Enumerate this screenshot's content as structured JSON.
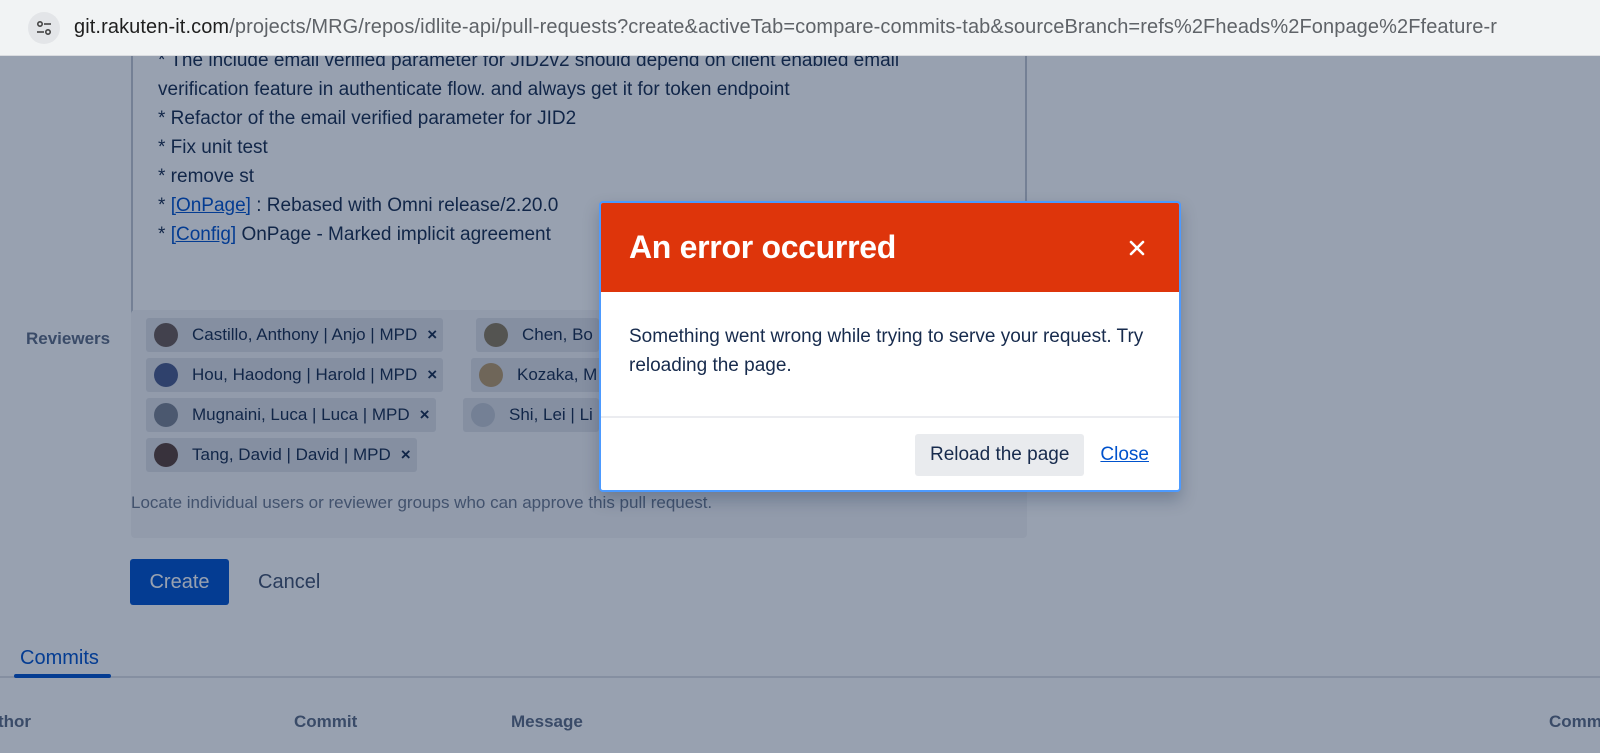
{
  "browser": {
    "url_host": "git.rakuten-it.com",
    "url_path": "/projects/MRG/repos/idlite-api/pull-requests?create&activeTab=compare-commits-tab&sourceBranch=refs%2Fheads%2Fonpage%2Ffeature-r"
  },
  "description": {
    "lines": [
      "* The include email verified parameter for JID2v2 should depend on client enabled email",
      "verification feature in authenticate flow. and always get it for token endpoint",
      "* Refactor of the email verified parameter for JID2",
      "* Fix unit test",
      "* remove st"
    ],
    "link_lines": [
      {
        "prefix": "* ",
        "link": "[OnPage]",
        "suffix": " : Rebased with Omni release/2.20.0"
      },
      {
        "prefix": "* ",
        "link": "[Config]",
        "suffix": " OnPage - Marked implicit agreement"
      }
    ]
  },
  "reviewers": {
    "label": "Reviewers",
    "chips": [
      "Castillo, Anthony | Anjo | MPD",
      "Chen, Bo",
      "Hou, Haodong | Harold | MPD",
      "Kozaka, M",
      "Mugnaini, Luca | Luca | MPD",
      "Shi, Lei | Li",
      "Tang, David | David | MPD"
    ],
    "remove_symbol": "×",
    "helper": "Locate individual users or reviewer groups who can approve this pull request."
  },
  "actions": {
    "create": "Create",
    "cancel": "Cancel"
  },
  "tabs": {
    "commits": "Commits"
  },
  "table": {
    "headers": [
      "thor",
      "Commit",
      "Message",
      "Comm"
    ]
  },
  "dialog": {
    "title": "An error occurred",
    "close_symbol": "×",
    "message": "Something went wrong while trying to serve your request. Try reloading the page.",
    "reload_label": "Reload the page",
    "close_label": "Close",
    "header_color": "#de350b"
  }
}
